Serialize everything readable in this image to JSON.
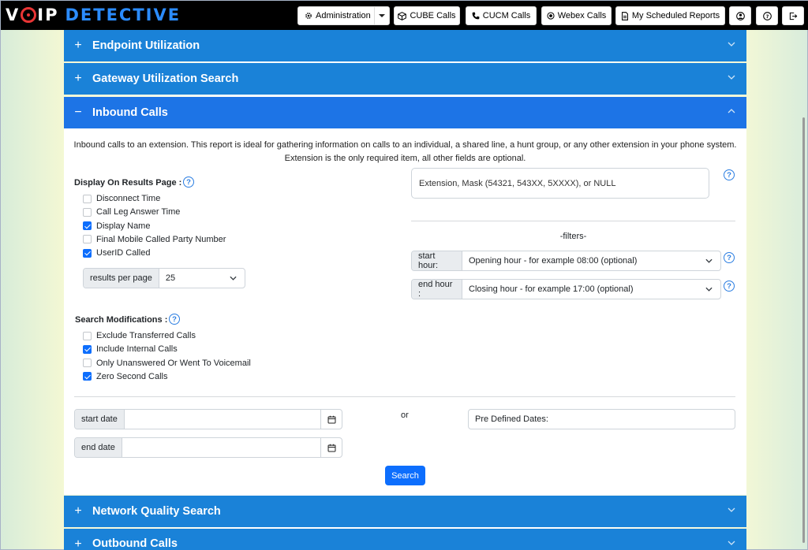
{
  "brand": {
    "first": "V",
    "mid": "IP",
    "second": "DETECTIVE"
  },
  "nav": {
    "administration": "Administration",
    "cube_calls": "CUBE Calls",
    "cucm_calls": "CUCM Calls",
    "webex_calls": "Webex Calls",
    "scheduled_reports": "My Scheduled Reports"
  },
  "sections": {
    "endpoint": "Endpoint Utilization",
    "gateway": "Gateway Utilization Search",
    "inbound": "Inbound Calls",
    "network": "Network Quality Search",
    "outbound": "Outbound Calls"
  },
  "signs": {
    "plus": "+",
    "minus": "−"
  },
  "inbound": {
    "intro_line1": "Inbound calls to an extension. This report is ideal for gathering information on calls to an individual, a shared line, a hunt group, or any other extension in your phone system.",
    "intro_line2": "Extension is the only required item, all other fields are optional.",
    "display_label": "Display On Results Page :",
    "display_options": [
      {
        "label": "Disconnect Time",
        "checked": false
      },
      {
        "label": "Call Leg Answer Time",
        "checked": false
      },
      {
        "label": "Display Name",
        "checked": true
      },
      {
        "label": "Final Mobile Called Party Number",
        "checked": false
      },
      {
        "label": "UserID Called",
        "checked": true
      }
    ],
    "results_per_page_label": "results per page",
    "results_per_page_value": "25",
    "extension_placeholder": "Extension, Mask (54321, 543XX, 5XXXX), or NULL",
    "filters_label": "-filters-",
    "start_hour_label": "start hour:",
    "start_hour_value": "Opening hour - for example 08:00 (optional)",
    "end_hour_label": "end hour :",
    "end_hour_value": "Closing hour - for example 17:00 (optional)",
    "search_mod_label": "Search Modifications :",
    "search_mod_options": [
      {
        "label": "Exclude Transferred Calls",
        "checked": false
      },
      {
        "label": "Include Internal Calls",
        "checked": true
      },
      {
        "label": "Only Unanswered Or Went To Voicemail",
        "checked": false
      },
      {
        "label": "Zero Second Calls",
        "checked": true
      }
    ],
    "start_date_label": "start date",
    "end_date_label": "end date",
    "or_label": "or",
    "predefined_label": "Pre Defined Dates:",
    "search_button": "Search",
    "help_glyph": "?"
  },
  "icons": {
    "cube": "cube-icon",
    "cucm": "phone-icon",
    "webex": "record-icon",
    "reports": "document-icon",
    "user": "user-circle-icon",
    "help": "question-circle-icon",
    "logout": "logout-icon",
    "calendar": "calendar-icon"
  },
  "colors": {
    "section_header": "#1a82d8",
    "active_header": "#1d74e6",
    "primary": "#0d6efd",
    "topbar": "#000000"
  }
}
